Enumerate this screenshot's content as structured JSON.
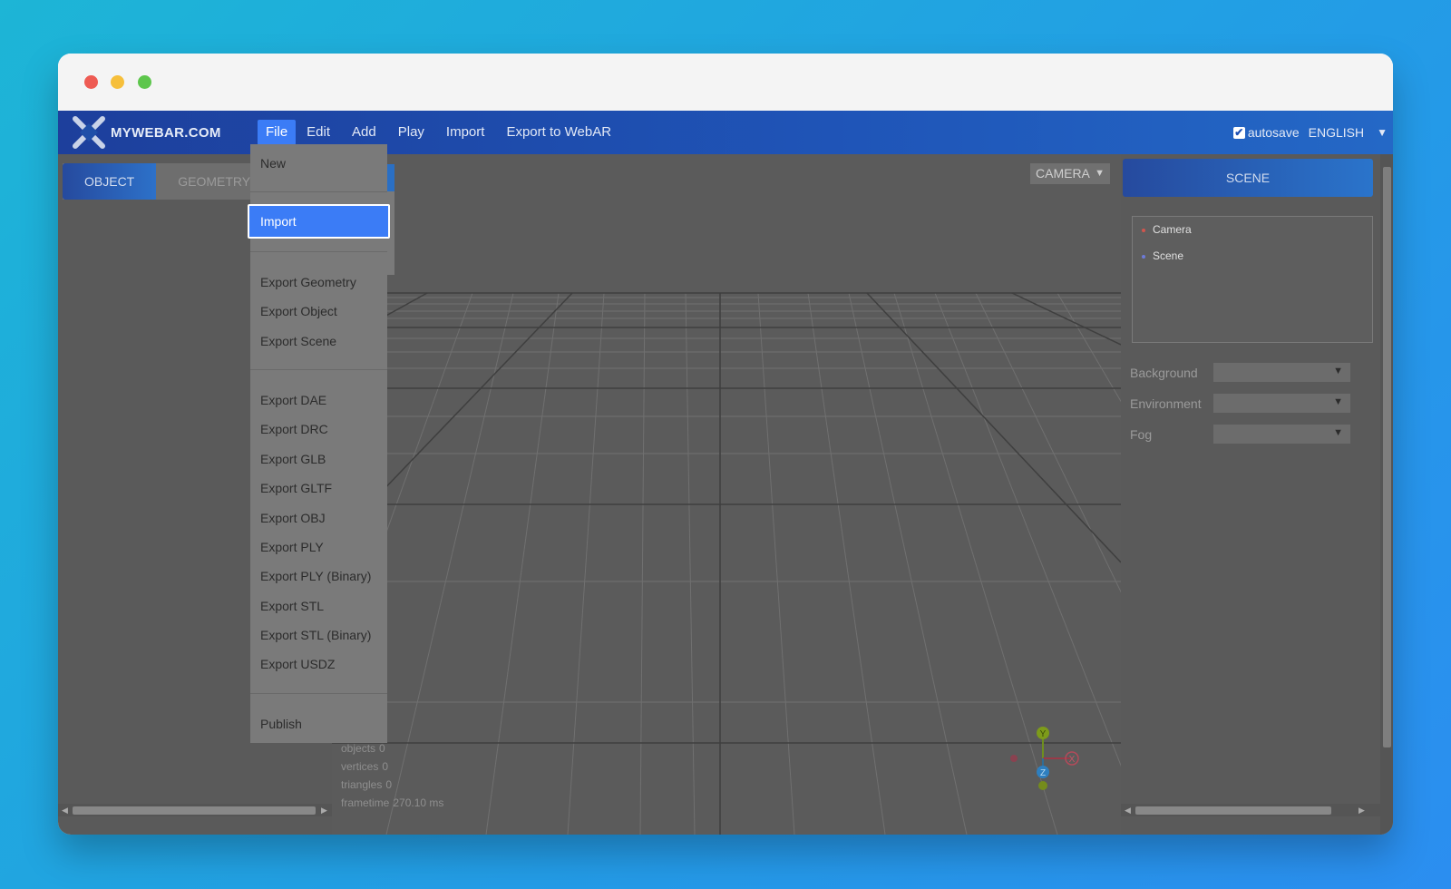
{
  "appbar": {
    "logo_text": "MYWEBAR.COM",
    "menu": [
      "File",
      "Edit",
      "Add",
      "Play",
      "Import",
      "Export to WebAR"
    ],
    "autosave_label": "autosave",
    "autosave_checked": true,
    "language": "ENGLISH"
  },
  "left_panel": {
    "tabs": [
      "OBJECT",
      "GEOMETRY"
    ],
    "active_tab": "OBJECT"
  },
  "viewport": {
    "camera_select": "CAMERA",
    "info": {
      "objects_label": "objects",
      "objects_value": "0",
      "vertices_label": "vertices",
      "vertices_value": "0",
      "triangles_label": "triangles",
      "triangles_value": "0",
      "frametime_label": "frametime",
      "frametime_value": "270.10 ms"
    },
    "gizmo": {
      "y": "Y",
      "x": "X",
      "z": "Z"
    }
  },
  "right_panel": {
    "tab": "SCENE",
    "outliner": [
      {
        "label": "Camera",
        "bullet_color": "#d0554d"
      },
      {
        "label": "Scene",
        "bullet_color": "#6d7bd8"
      }
    ],
    "properties": [
      "Background",
      "Environment",
      "Fog"
    ]
  },
  "file_menu": {
    "new": "New",
    "import": "Import",
    "export_group1": [
      "Export Geometry",
      "Export Object",
      "Export Scene"
    ],
    "export_group2": [
      "Export DAE",
      "Export DRC",
      "Export GLB",
      "Export GLTF",
      "Export OBJ",
      "Export PLY",
      "Export PLY (Binary)",
      "Export STL",
      "Export STL (Binary)",
      "Export USDZ"
    ],
    "publish": "Publish"
  },
  "colors": {
    "accent": "#3b7cf6",
    "appbar": "#1f55b8",
    "overlay_gray": "#5a5a5a"
  }
}
